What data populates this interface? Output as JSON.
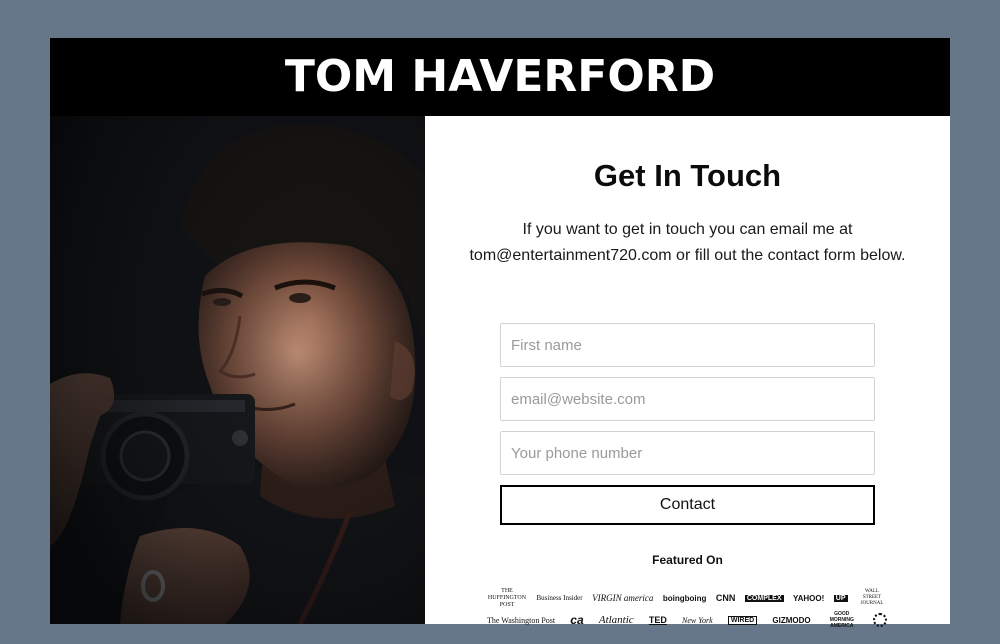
{
  "header": {
    "brand": "TOM HAVERFORD"
  },
  "contact": {
    "title": "Get In Touch",
    "intro_line1": "If you want to get in touch you can email me at",
    "intro_line2": "tom@entertainment720.com or fill out the contact form below.",
    "fields": {
      "first_name_placeholder": "First name",
      "email_placeholder": "email@website.com",
      "phone_placeholder": "Your phone number"
    },
    "button_label": "Contact"
  },
  "featured": {
    "heading": "Featured On",
    "row1": [
      "THE HUFFINGTON POST",
      "Business Insider",
      "VIRGIN america",
      "boingboing",
      "CNN",
      "COMPLEX",
      "YAHOO!",
      "UP",
      "WALL STREET JOURNAL"
    ],
    "row2": [
      "The Washington Post",
      "ca",
      "Atlantic",
      "TED",
      "New York",
      "WIRED",
      "GIZMODO",
      "GOOD MORNING AMERICA",
      "CBS"
    ]
  },
  "colors": {
    "page_bg": "#66778a",
    "header_bg": "#000000",
    "accent": "#000000"
  },
  "icons": {
    "photo": "photographer-portrait",
    "cbs": "circle-logo-icon"
  }
}
